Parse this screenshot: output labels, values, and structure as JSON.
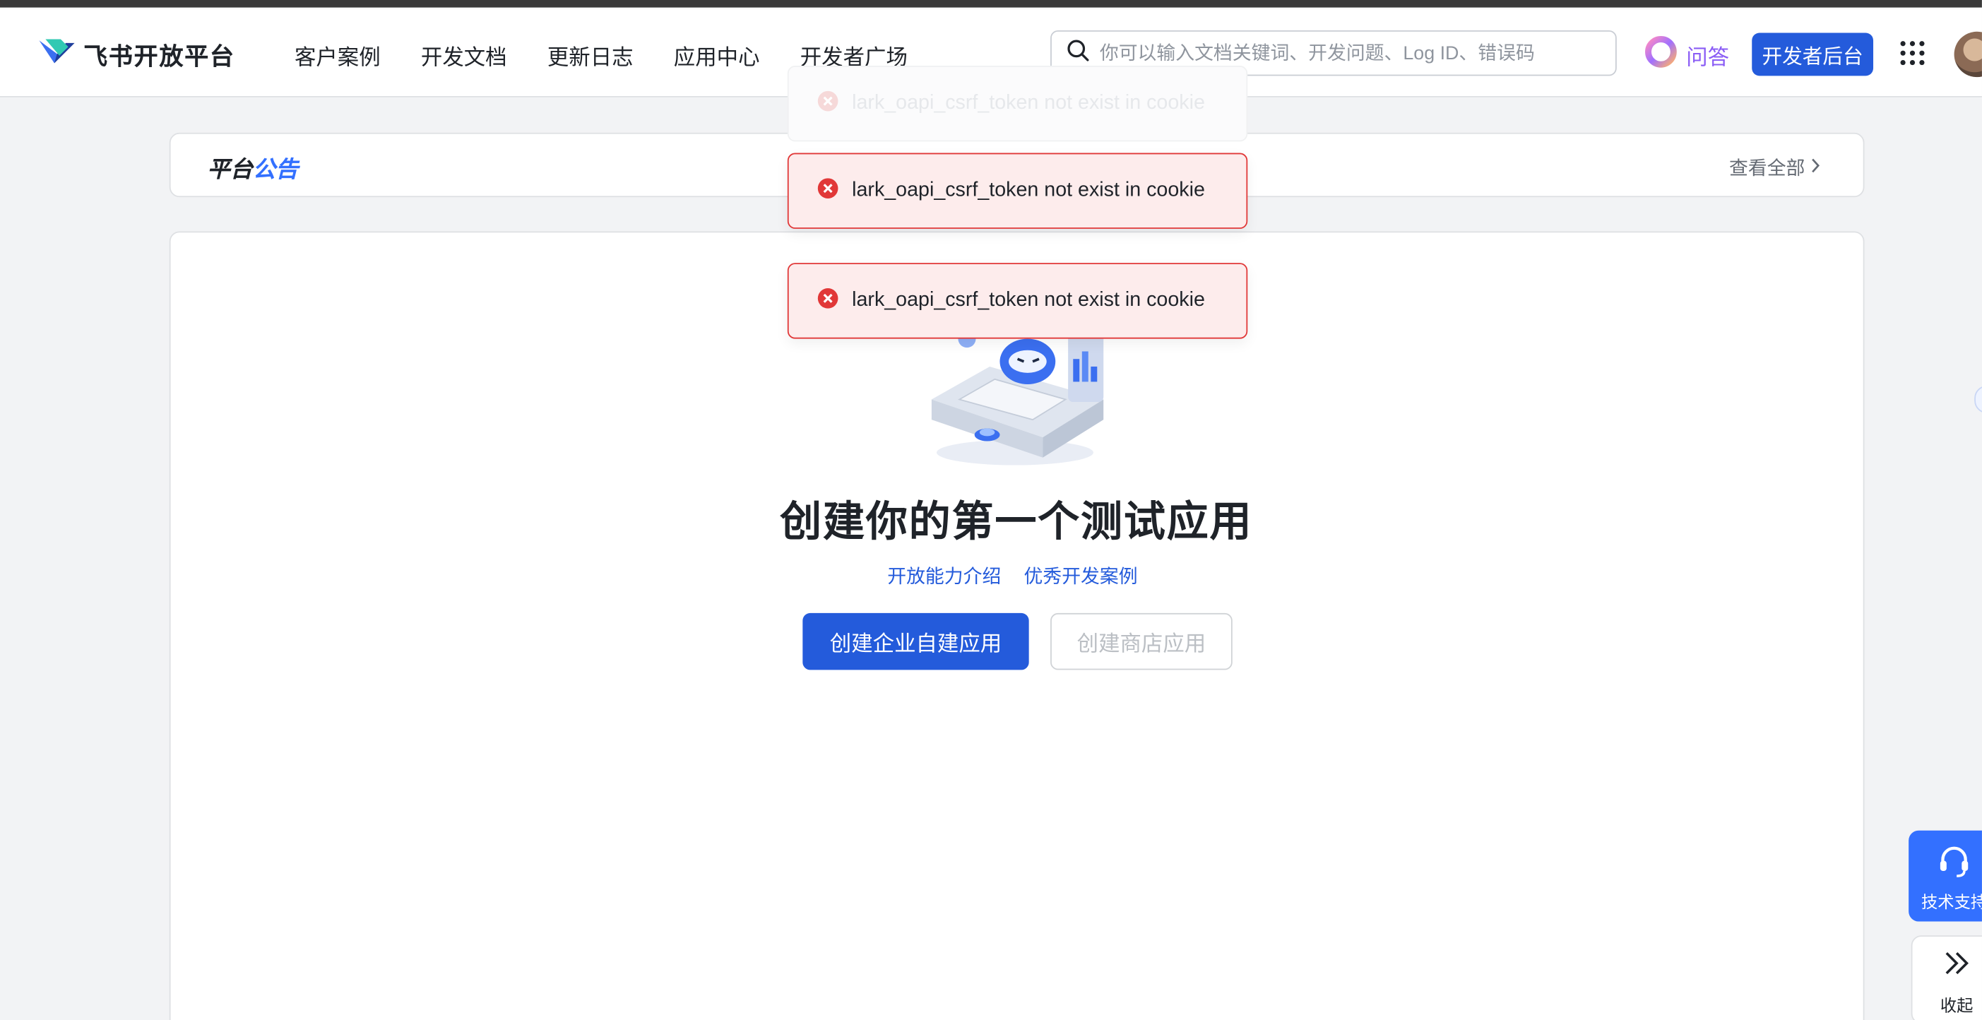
{
  "brand": {
    "name": "飞书开放平台"
  },
  "nav": {
    "items": [
      "客户案例",
      "开发文档",
      "更新日志",
      "应用中心",
      "开发者广场"
    ]
  },
  "search": {
    "placeholder": "你可以输入文档关键词、开发问题、Log ID、错误码"
  },
  "header": {
    "qa_label": "问答",
    "dev_console_label": "开发者后台"
  },
  "notice": {
    "title_part1": "平台",
    "title_part2": "公告",
    "view_all": "查看全部"
  },
  "toasts": [
    {
      "text": "lark_oapi_csrf_token not exist in cookie",
      "state": "fading"
    },
    {
      "text": "lark_oapi_csrf_token not exist in cookie",
      "state": "visible"
    },
    {
      "text": "lark_oapi_csrf_token not exist in cookie",
      "state": "visible"
    }
  ],
  "empty_state": {
    "title": "创建你的第一个测试应用",
    "links": [
      "开放能力介绍",
      "优秀开发案例"
    ],
    "primary_button": "创建企业自建应用",
    "secondary_button": "创建商店应用"
  },
  "side": {
    "support_label": "技术支持",
    "collapse_label": "收起"
  },
  "colors": {
    "brand_blue": "#245bdb",
    "accent_blue": "#3370ff",
    "error_red": "#e13838",
    "qa_purple": "#8a5cf5"
  }
}
